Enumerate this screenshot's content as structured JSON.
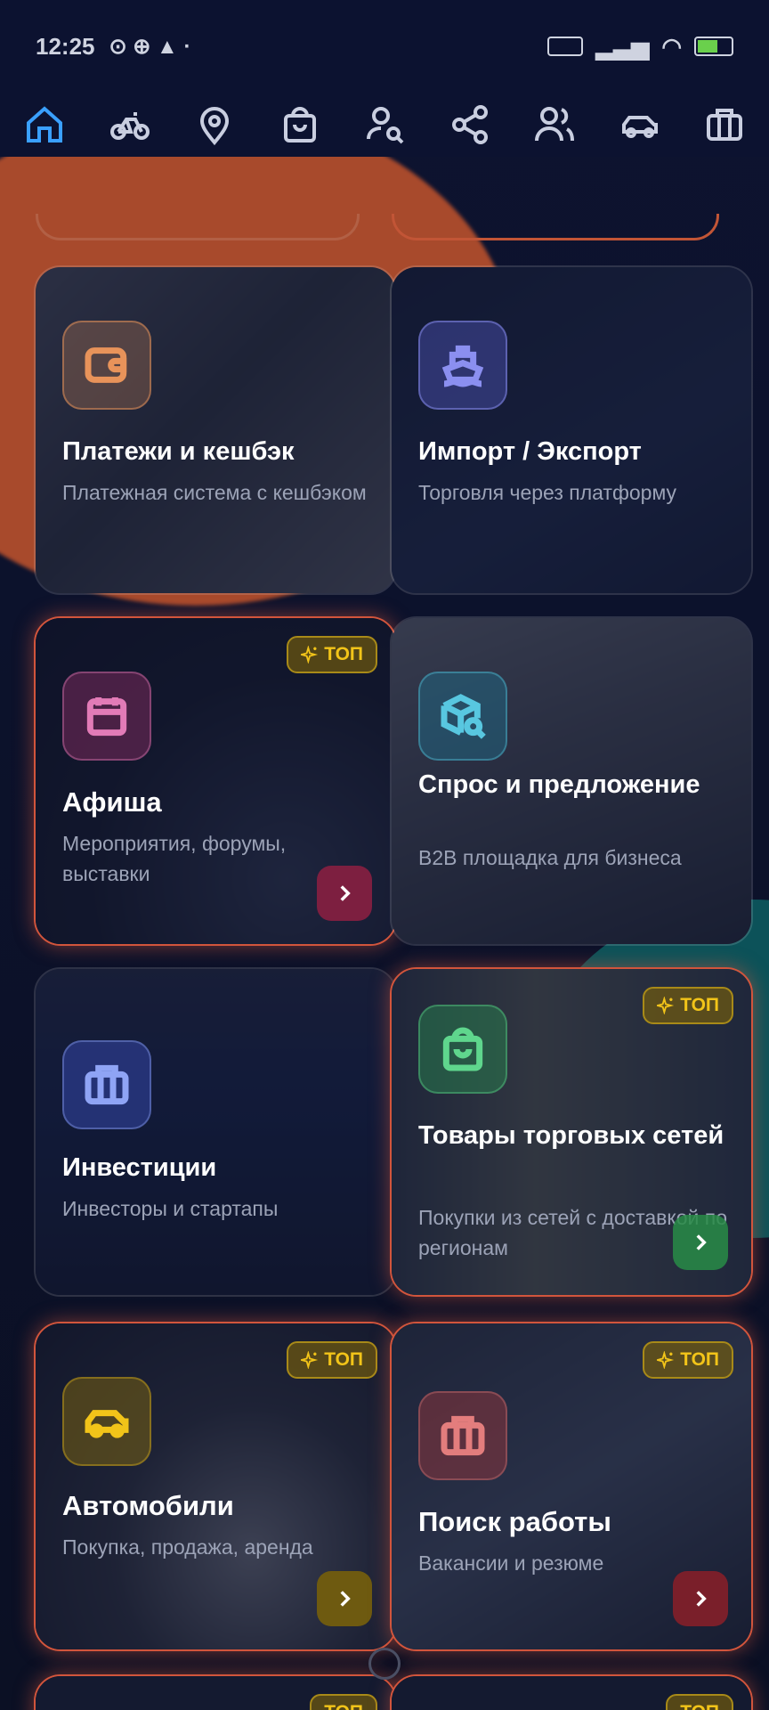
{
  "status_bar": {
    "time": "12:25",
    "battery": "5"
  },
  "top_nav": [
    {
      "name": "home",
      "active": true
    },
    {
      "name": "bike"
    },
    {
      "name": "location"
    },
    {
      "name": "shop-bag"
    },
    {
      "name": "user-search"
    },
    {
      "name": "share"
    },
    {
      "name": "users"
    },
    {
      "name": "car"
    },
    {
      "name": "briefcase"
    }
  ],
  "badge_label": "ТОП",
  "cards": [
    {
      "id": "payments",
      "title": "Платежи и кешбэк",
      "subtitle": "Платежная система с кешбэком",
      "icon": "wallet-icon",
      "accent": "#e8935a",
      "top": false,
      "arrow": false
    },
    {
      "id": "import-export",
      "title": "Импорт / Экспорт",
      "subtitle": "Торговля через платформу",
      "icon": "ship-icon",
      "accent": "#8b8ff0",
      "top": false,
      "arrow": false
    },
    {
      "id": "afisha",
      "title": "Афиша",
      "subtitle": "Мероприятия, форумы, выставки",
      "icon": "calendar-icon",
      "accent": "#e27bb7",
      "top": true,
      "arrow": true
    },
    {
      "id": "demand-supply",
      "title": "Спрос и предложение",
      "subtitle": "B2B площадка для бизнеса",
      "icon": "box-search-icon",
      "accent": "#58c7e0",
      "top": false,
      "arrow": false
    },
    {
      "id": "investments",
      "title": "Инвестиции",
      "subtitle": "Инвесторы и стартапы",
      "icon": "briefcase-icon",
      "accent": "#8fa4f5",
      "top": false,
      "arrow": false
    },
    {
      "id": "retail-goods",
      "title": "Товары торговых сетей",
      "subtitle": "Покупки из сетей с доставкой по регионам",
      "icon": "bag-icon",
      "accent": "#5fd68d",
      "top": true,
      "arrow": true
    },
    {
      "id": "cars",
      "title": "Автомобили",
      "subtitle": "Покупка, продажа, аренда",
      "icon": "car-icon",
      "accent": "#f2c419",
      "top": true,
      "arrow": true
    },
    {
      "id": "jobs",
      "title": "Поиск работы",
      "subtitle": "Вакансии и резюме",
      "icon": "briefcase-icon",
      "accent": "#e37d7d",
      "top": true,
      "arrow": true
    }
  ]
}
